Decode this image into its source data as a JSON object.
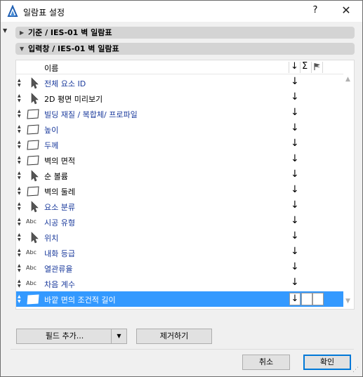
{
  "window": {
    "title": "일람표 설정",
    "help_label": "?",
    "close_label": "✕"
  },
  "sections": {
    "criteria": {
      "label": "기준 / IES-01 벽 일람표",
      "expanded": false
    },
    "input": {
      "label": "입력창 / IES-01 벽 일람표",
      "expanded": true
    }
  },
  "list": {
    "header": {
      "name": "이름",
      "sort_icon": "↓",
      "sum_icon": "Σ",
      "flag_icon": "flag-icon"
    },
    "rows": [
      {
        "icon": "pointer-icon",
        "label": "전체 요소 ID",
        "color": "blue",
        "selected": false
      },
      {
        "icon": "pointer-icon",
        "label": "2D 평면 미리보기",
        "color": "black",
        "selected": false
      },
      {
        "icon": "shape-icon",
        "label": "빌딩 재질 / 복합체/ 프로파일",
        "color": "blue",
        "selected": false
      },
      {
        "icon": "shape-icon",
        "label": "높이",
        "color": "blue",
        "selected": false
      },
      {
        "icon": "shape-icon",
        "label": "두께",
        "color": "blue",
        "selected": false
      },
      {
        "icon": "shape-icon",
        "label": "벽의 면적",
        "color": "black",
        "selected": false
      },
      {
        "icon": "pointer-icon",
        "label": "순 볼륨",
        "color": "black",
        "selected": false
      },
      {
        "icon": "shape-icon",
        "label": "벽의 둘레",
        "color": "black",
        "selected": false
      },
      {
        "icon": "pointer-icon",
        "label": "요소 분류",
        "color": "blue",
        "selected": false
      },
      {
        "icon": "abc-icon",
        "label": "시공 유형",
        "color": "blue",
        "selected": false
      },
      {
        "icon": "pointer-icon",
        "label": "위치",
        "color": "blue",
        "selected": false
      },
      {
        "icon": "abc-icon",
        "label": "내화 등급",
        "color": "blue",
        "selected": false
      },
      {
        "icon": "abc-icon",
        "label": "열관류율",
        "color": "blue",
        "selected": false
      },
      {
        "icon": "abc-icon",
        "label": "차음 계수",
        "color": "blue",
        "selected": false
      },
      {
        "icon": "shape-icon",
        "label": "바깥 면의 조건적 길이",
        "color": "blue",
        "selected": true
      }
    ],
    "row_sort_glyph": "↓",
    "abc_text": "Abc"
  },
  "buttons": {
    "add_field": "필드 추가...",
    "remove": "제거하기",
    "cancel": "취소",
    "ok": "확인"
  },
  "colors": {
    "selection": "#3399ff",
    "blue_text": "#1a3a9c",
    "section_bg": "#d4d4d4",
    "primary_border": "#0078d7"
  }
}
